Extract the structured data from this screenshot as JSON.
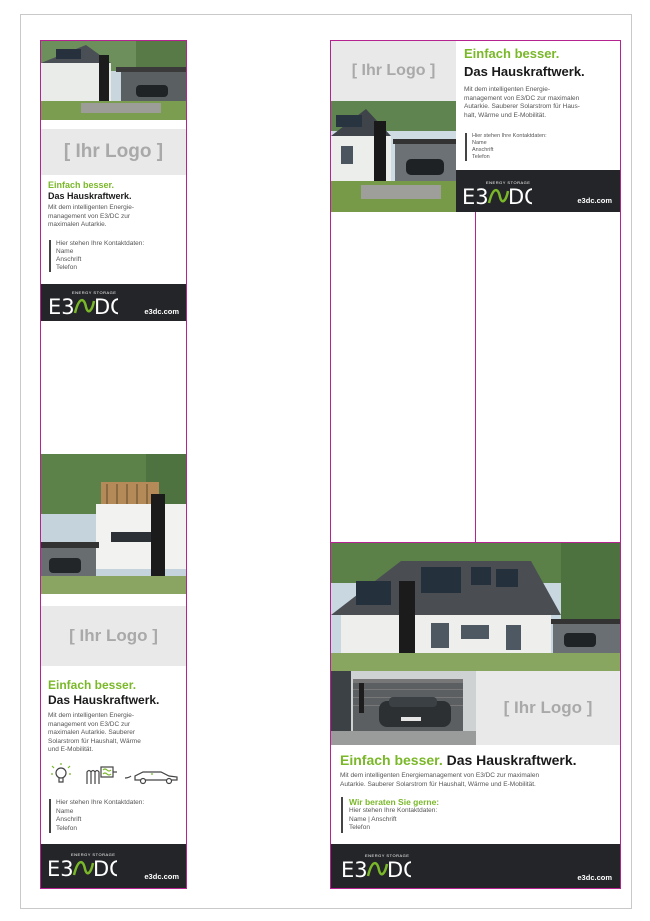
{
  "colors": {
    "accent": "#7ab829",
    "footer": "#232528",
    "guide": "#b4238f",
    "logo_box": "#e9e9e9"
  },
  "ad_a": {
    "logo_placeholder": "[ Ihr Logo ]",
    "headline_1": "Einfach besser.",
    "headline_2": "Das Hauskraftwerk.",
    "body_lines": [
      "Mit dem intelligenten Energie-",
      "management von E3/DC zur",
      "maximalen Autarkie."
    ],
    "contact_lines": [
      "Hier stehen Ihre Kontaktdaten:",
      "Name",
      "Anschrift",
      "Telefon"
    ],
    "brand_tag": "ENERGY STORAGE",
    "url": "e3dc.com"
  },
  "ad_b": {
    "logo_placeholder": "[ Ihr Logo ]",
    "headline_1": "Einfach besser.",
    "headline_2": "Das Hauskraftwerk.",
    "body_lines": [
      "Mit dem intelligenten Energie-",
      "management von E3/DC zur maximalen",
      "Autarkie. Sauberer Solarstrom für Haus-",
      "halt, Wärme und E-Mobilität."
    ],
    "contact_lines": [
      "Hier stehen Ihre Kontaktdaten:",
      "Name",
      "Anschrift",
      "Telefon"
    ],
    "brand_tag": "ENERGY STORAGE",
    "url": "e3dc.com"
  },
  "ad_c": {
    "logo_placeholder": "[ Ihr Logo ]",
    "headline_1": "Einfach besser.",
    "headline_2": "Das Hauskraftwerk.",
    "body_lines": [
      "Mit dem intelligenten Energie-",
      "management von E3/DC zur",
      "maximalen Autarkie. Sauberer",
      "Solarstrom für Haushalt, Wärme",
      "und E-Mobilität."
    ],
    "icons": [
      "light-bulb-icon",
      "heat-pump-icon",
      "electric-car-icon"
    ],
    "contact_lines": [
      "Hier stehen Ihre Kontaktdaten:",
      "Name",
      "Anschrift",
      "Telefon"
    ],
    "brand_tag": "ENERGY STORAGE",
    "url": "e3dc.com"
  },
  "ad_d": {
    "logo_placeholder": "[ Ihr Logo ]",
    "headline_1": "Einfach besser.",
    "headline_2": "Das Hauskraftwerk.",
    "body_lines": [
      "Mit dem intelligenten Energiemanagement von E3/DC zur maximalen",
      "Autarkie. Sauberer Solarstrom für Haushalt, Wärme und E-Mobilität."
    ],
    "advice": "Wir beraten Sie gerne:",
    "contact_lines": [
      "Hier stehen Ihre Kontaktdaten:",
      "Name | Anschrift",
      "Telefon"
    ],
    "brand_tag": "ENERGY STORAGE",
    "url": "e3dc.com"
  }
}
